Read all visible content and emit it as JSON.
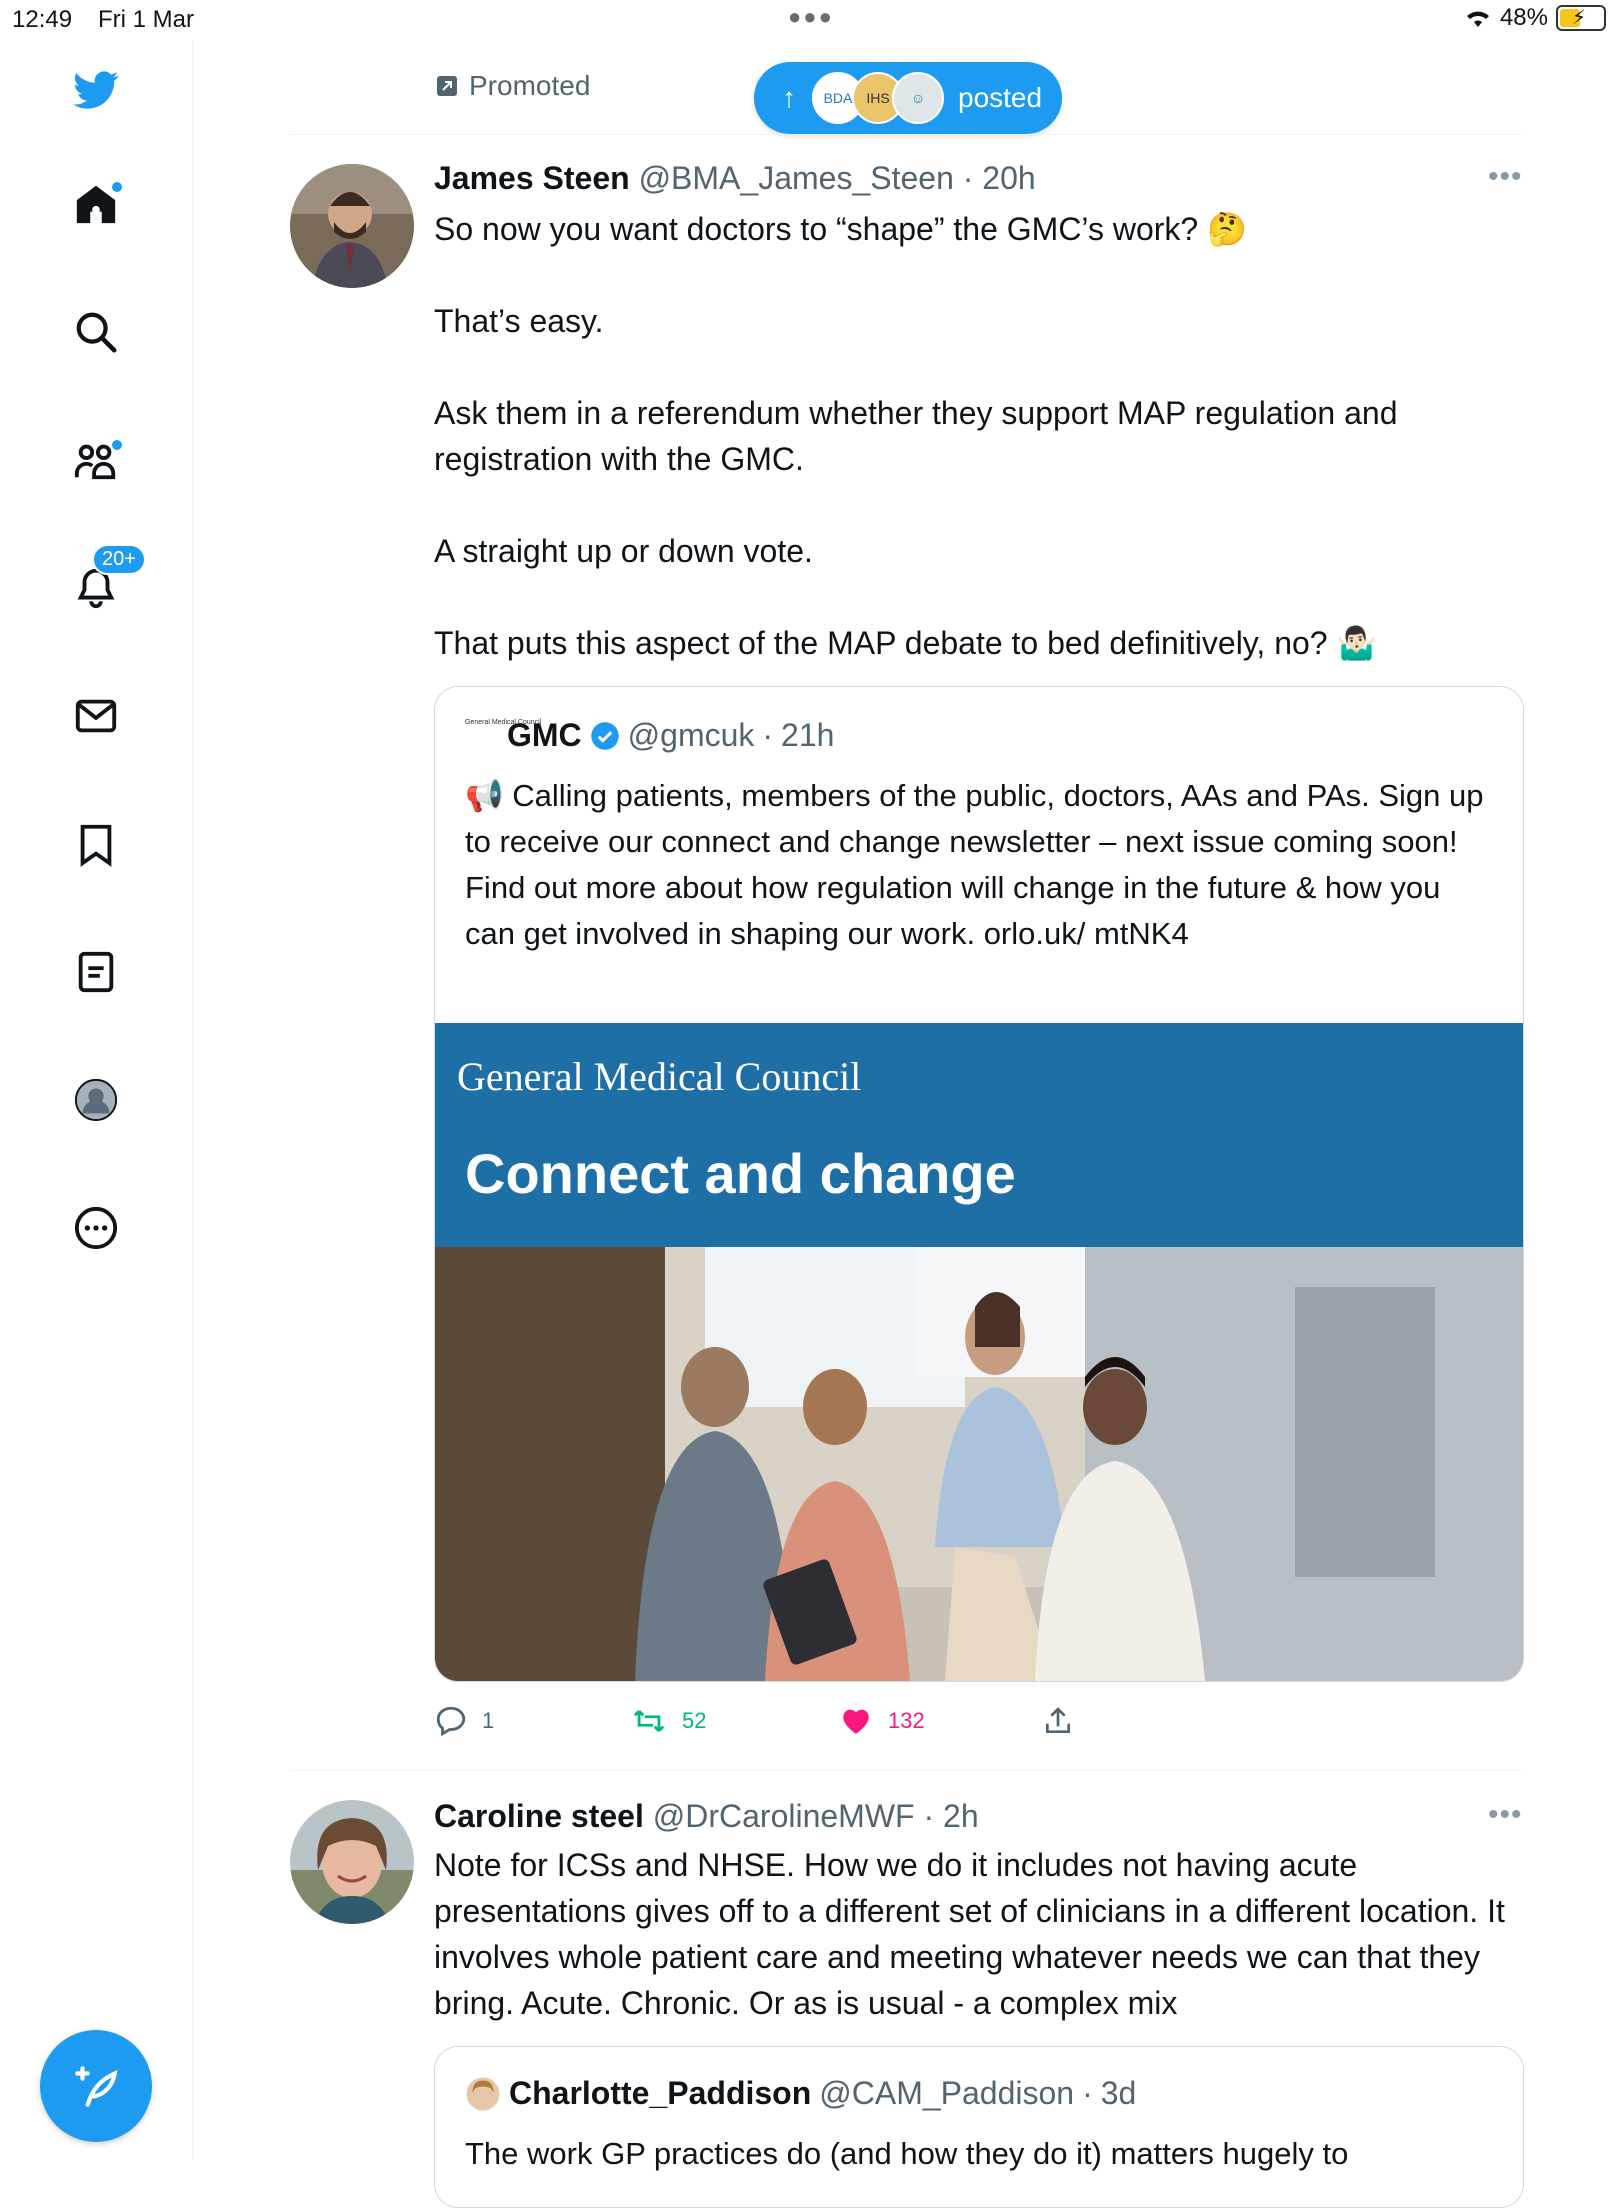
{
  "status_bar": {
    "time": "12:49",
    "date": "Fri 1 Mar",
    "battery": "48%"
  },
  "sidebar": {
    "notifications_badge": "20+",
    "items": [
      "twitter-logo",
      "home",
      "search",
      "communities",
      "notifications",
      "messages",
      "bookmarks",
      "lists",
      "profile",
      "more"
    ]
  },
  "feed": {
    "promoted_label": "Promoted",
    "posted_pill": {
      "label": "posted",
      "avatar_1": "BDA",
      "avatar_2": "IHS"
    },
    "tweet1": {
      "name": "James Steen",
      "handle": "@BMA_James_Steen",
      "time": "20h",
      "lines": [
        "So now you want doctors to “shape” the GMC’s work? 🤔",
        "That’s easy.",
        "Ask them in a referendum whether they support MAP regulation and registration with the GMC.",
        "A straight up or down vote.",
        "That puts this aspect of the MAP debate to bed definitively, no? 🤷🏻‍♂️"
      ],
      "quote": {
        "avatar_text": "General Medical Council",
        "name": "GMC",
        "handle": "@gmcuk",
        "time": "21h",
        "text": "📢 Calling patients, members of the public, doctors, AAs and PAs. Sign up to receive our connect and change newsletter – next issue coming soon! Find out more about how regulation will change in the future & how you can get involved in shaping our work. orlo.uk/ mtNK4",
        "banner_org": "General Medical Council",
        "banner_headline": "Connect and change"
      },
      "replies": "1",
      "retweets": "52",
      "likes": "132"
    },
    "tweet2": {
      "name": "Caroline steel",
      "handle": "@DrCarolineMWF",
      "time": "2h",
      "text": "Note for ICSs and NHSE. How we do it includes not having acute presentations gives off to a different set of clinicians in a different location. It involves whole patient care and meeting whatever needs we can that they bring. Acute. Chronic. Or as is usual - a complex mix",
      "quote": {
        "name": "Charlotte_Paddison",
        "handle": "@CAM_Paddison",
        "time": "3d",
        "text": "The work GP practices do (and how they do it) matters hugely to"
      }
    }
  },
  "colors": {
    "accent": "#1d9bf0",
    "retweet": "#00ba7c",
    "like": "#f91880",
    "gmc_blue": "#1d6fa6"
  }
}
